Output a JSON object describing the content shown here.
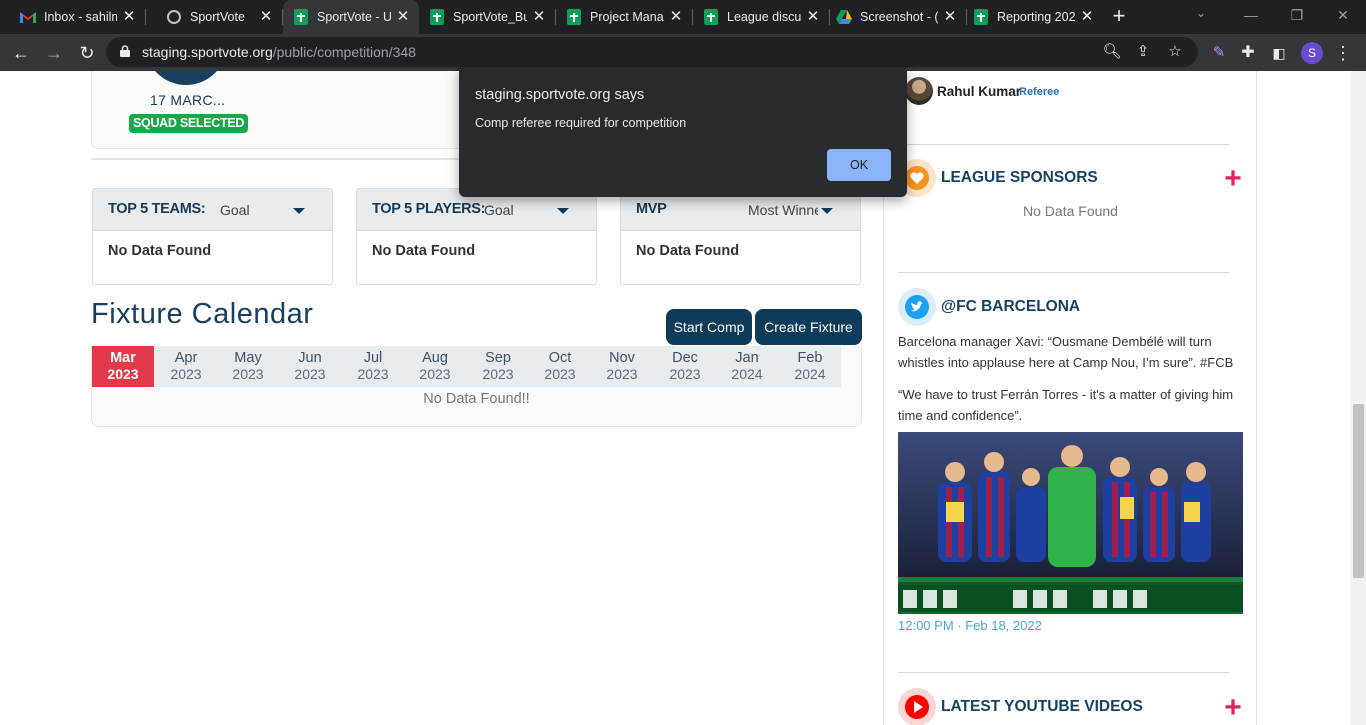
{
  "browser": {
    "tabs": [
      {
        "title": "Inbox - sahilm",
        "icon": "gmail-icon"
      },
      {
        "title": "SportVote",
        "icon": "globe-icon"
      },
      {
        "title": "SportVote - U",
        "icon": "sheets-icon"
      },
      {
        "title": "SportVote_Bu",
        "icon": "sheets-icon"
      },
      {
        "title": "Project Manag",
        "icon": "sheets-icon"
      },
      {
        "title": "League discus",
        "icon": "sheets-icon"
      },
      {
        "title": "Screenshot - (",
        "icon": "drive-icon"
      },
      {
        "title": "Reporting 202",
        "icon": "sheets-icon"
      }
    ],
    "url_host": "staging.sportvote.org",
    "url_path": "/public/competition/348",
    "profile_initial": "S"
  },
  "match": {
    "date": "17 MARC...",
    "status": "SQUAD SELECTED"
  },
  "stats": [
    {
      "title": "TOP 5 TEAMS:",
      "select": "Goal",
      "body": "No Data Found"
    },
    {
      "title": "TOP 5 PLAYERS:",
      "select": "Goal",
      "body": "No Data Found"
    },
    {
      "title": "MVP",
      "select": "Most Winne",
      "body": "No Data Found"
    }
  ],
  "fixture": {
    "title": "Fixture Calendar",
    "start_btn": "Start Comp",
    "create_btn": "Create Fixture",
    "months": [
      {
        "m": "Mar",
        "y": "2023"
      },
      {
        "m": "Apr",
        "y": "2023"
      },
      {
        "m": "May",
        "y": "2023"
      },
      {
        "m": "Jun",
        "y": "2023"
      },
      {
        "m": "Jul",
        "y": "2023"
      },
      {
        "m": "Aug",
        "y": "2023"
      },
      {
        "m": "Sep",
        "y": "2023"
      },
      {
        "m": "Oct",
        "y": "2023"
      },
      {
        "m": "Nov",
        "y": "2023"
      },
      {
        "m": "Dec",
        "y": "2023"
      },
      {
        "m": "Jan",
        "y": "2024"
      },
      {
        "m": "Feb",
        "y": "2024"
      }
    ],
    "nodata": "No Data Found!!"
  },
  "sidebar": {
    "referee_name": "Rahul Kumar",
    "referee_role": "Referee",
    "sponsors_title": "LEAGUE SPONSORS",
    "sponsors_nodata": "No Data Found",
    "twitter_title": "@FC BARCELONA",
    "tweet1": "Barcelona manager Xavi: “Ousmane Dembélé will turn whistles into applause here at Camp Nou, I’m sure”. #FCB",
    "tweet2": "“We have to trust Ferrán Torres - it's a matter of giving him time and confidence”.",
    "tweet_time": "12:00 PM · Feb 18, 2022",
    "youtube_title": "LATEST YOUTUBE VIDEOS"
  },
  "dialog": {
    "title": "staging.sportvote.org says",
    "message": "Comp referee required for competition",
    "ok": "OK"
  },
  "colors": {
    "brand_navy": "#17415f",
    "accent_red": "#e23a4a",
    "success_green": "#17a84a",
    "plus_pink": "#e0245e",
    "dialog_ok": "#8ab4f8"
  }
}
